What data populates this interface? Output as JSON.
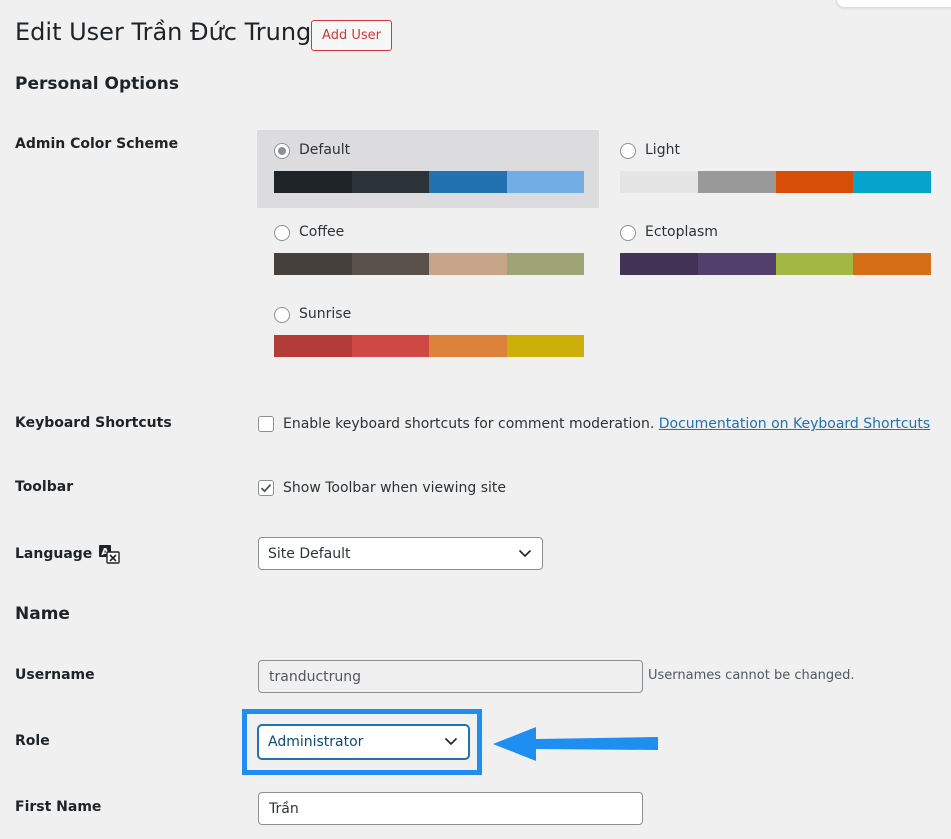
{
  "header": {
    "title": "Edit User Trần Đức Trung",
    "add_user_label": "Add User"
  },
  "personal_options": {
    "section_title": "Personal Options",
    "color_scheme_label": "Admin Color Scheme",
    "schemes": [
      {
        "name": "Default",
        "selected": true,
        "colors": [
          "#1d2327",
          "#2c3338",
          "#2271b1",
          "#72aee6"
        ]
      },
      {
        "name": "Light",
        "selected": false,
        "colors": [
          "#e5e5e5",
          "#999999",
          "#d64e07",
          "#04a4cc"
        ]
      },
      {
        "name": "Coffee",
        "selected": false,
        "colors": [
          "#46403c",
          "#59524c",
          "#c7a589",
          "#9ea476"
        ]
      },
      {
        "name": "Ectoplasm",
        "selected": false,
        "colors": [
          "#413256",
          "#523f6d",
          "#a3b745",
          "#d46f15"
        ]
      },
      {
        "name": "Sunrise",
        "selected": false,
        "colors": [
          "#b43c38",
          "#cf4944",
          "#dd823b",
          "#ccaf0b"
        ]
      }
    ],
    "keyboard_shortcuts": {
      "label": "Keyboard Shortcuts",
      "checked": false,
      "text": "Enable keyboard shortcuts for comment moderation.",
      "link_text": "Documentation on Keyboard Shortcuts"
    },
    "toolbar": {
      "label": "Toolbar",
      "checked": true,
      "text": "Show Toolbar when viewing site"
    },
    "language": {
      "label": "Language",
      "icon": "translation-icon",
      "selected": "Site Default"
    }
  },
  "name_section": {
    "section_title": "Name",
    "username": {
      "label": "Username",
      "value": "tranductrung",
      "description": "Usernames cannot be changed."
    },
    "role": {
      "label": "Role",
      "selected": "Administrator"
    },
    "first_name": {
      "label": "First Name",
      "value": "Trần"
    }
  },
  "annotation": {
    "highlight_color": "#1f8ef1",
    "arrow_color": "#1f8ef1"
  }
}
